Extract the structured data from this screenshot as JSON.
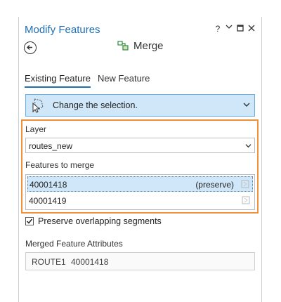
{
  "pane": {
    "title": "Modify Features",
    "controls": {
      "help": "?",
      "options": "⌄",
      "maximize": "□",
      "close": "✕"
    }
  },
  "tool": {
    "name": "Merge",
    "icon": "merge-icon",
    "back_icon": "back-arrow-icon"
  },
  "tabs": [
    {
      "label": "Existing Feature",
      "active": true
    },
    {
      "label": "New Feature",
      "active": false
    }
  ],
  "selection": {
    "label": "Change the selection.",
    "icon": "select-cursor-icon"
  },
  "layer": {
    "label": "Layer",
    "value": "routes_new"
  },
  "features": {
    "label": "Features to merge",
    "items": [
      {
        "id": "40001418",
        "tag": "(preserve)",
        "selected": true
      },
      {
        "id": "40001419",
        "tag": "",
        "selected": false
      }
    ]
  },
  "preserve_overlap": {
    "label": "Preserve overlapping segments",
    "checked": true
  },
  "merged_attributes": {
    "label": "Merged Feature Attributes",
    "field": "ROUTE1",
    "value": "40001418"
  },
  "colors": {
    "accent": "#1f6fb5",
    "highlight_box": "#f0903a",
    "selection_fill": "#cfe7f8"
  }
}
